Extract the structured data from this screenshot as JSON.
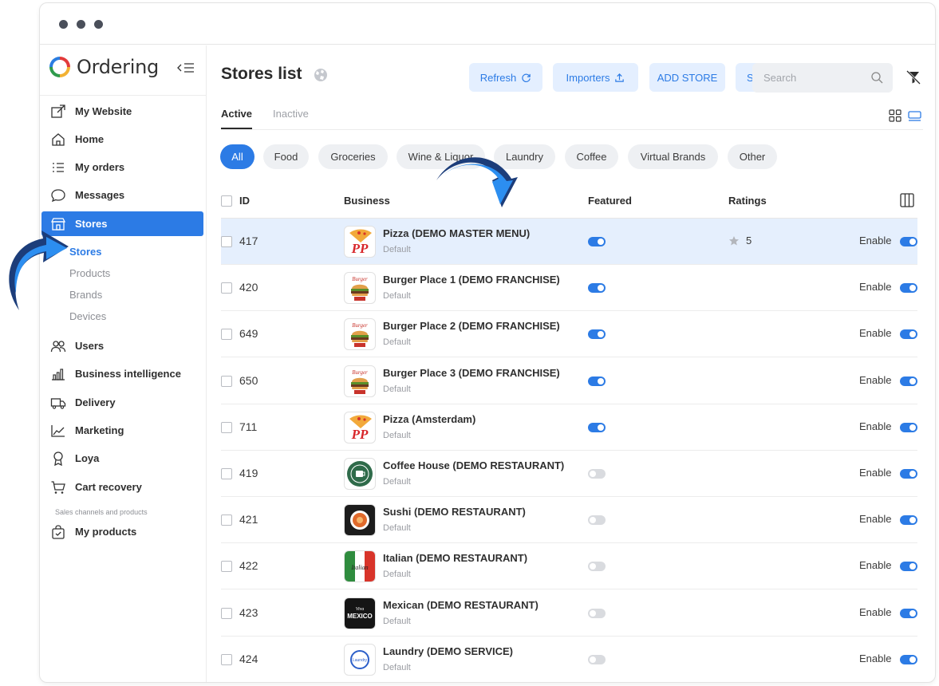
{
  "app": {
    "logo_text": "Ordering"
  },
  "colors": {
    "accent": "#2c7be5",
    "accent_light": "#e4efff",
    "row_highlight": "#e5effd"
  },
  "sidebar": {
    "items": [
      {
        "label": "My Website",
        "icon": "external-link-icon"
      },
      {
        "label": "Home",
        "icon": "home-icon"
      },
      {
        "label": "My orders",
        "icon": "list-icon"
      },
      {
        "label": "Messages",
        "icon": "chat-bubble-icon"
      },
      {
        "label": "Stores",
        "icon": "store-icon",
        "active": true
      },
      {
        "label": "Users",
        "icon": "users-icon"
      },
      {
        "label": "Business intelligence",
        "icon": "bar-chart-icon"
      },
      {
        "label": "Delivery",
        "icon": "truck-icon"
      },
      {
        "label": "Marketing",
        "icon": "line-chart-icon"
      },
      {
        "label": "Loya",
        "icon": "award-icon"
      },
      {
        "label": "Cart recovery",
        "icon": "cart-icon"
      },
      {
        "label": "My products",
        "icon": "bag-check-icon"
      }
    ],
    "sub_items": [
      "Stores",
      "Products",
      "Brands",
      "Devices"
    ],
    "caption": "Sales channels and products"
  },
  "header": {
    "title": "Stores list",
    "buttons": {
      "refresh": "Refresh",
      "importers": "Importers",
      "add_store": "ADD STORE",
      "sync": "Sync"
    },
    "search_placeholder": "Search"
  },
  "tabs": [
    "Active",
    "Inactive"
  ],
  "chips": [
    "All",
    "Food",
    "Groceries",
    "Wine & Liquor",
    "Laundry",
    "Coffee",
    "Virtual Brands",
    "Other"
  ],
  "table": {
    "columns": {
      "id": "ID",
      "business": "Business",
      "featured": "Featured",
      "ratings": "Ratings"
    },
    "rows": [
      {
        "id": "417",
        "name": "Pizza (DEMO MASTER MENU)",
        "sub": "Default",
        "featured": true,
        "rating": "5",
        "status": "Enable",
        "logo": "pizza-logo"
      },
      {
        "id": "420",
        "name": "Burger Place 1 (DEMO FRANCHISE)",
        "sub": "Default",
        "featured": true,
        "rating": "",
        "status": "Enable",
        "logo": "burger-logo"
      },
      {
        "id": "649",
        "name": "Burger Place 2 (DEMO FRANCHISE)",
        "sub": "Default",
        "featured": true,
        "rating": "",
        "status": "Enable",
        "logo": "burger-logo"
      },
      {
        "id": "650",
        "name": "Burger Place 3 (DEMO FRANCHISE)",
        "sub": "Default",
        "featured": true,
        "rating": "",
        "status": "Enable",
        "logo": "burger-logo"
      },
      {
        "id": "711",
        "name": "Pizza (Amsterdam)",
        "sub": "Default",
        "featured": true,
        "rating": "",
        "status": "Enable",
        "logo": "pizza-logo"
      },
      {
        "id": "419",
        "name": "Coffee House (DEMO RESTAURANT)",
        "sub": "Default",
        "featured": false,
        "rating": "",
        "status": "Enable",
        "logo": "coffee-logo"
      },
      {
        "id": "421",
        "name": "Sushi (DEMO RESTAURANT)",
        "sub": "Default",
        "featured": false,
        "rating": "",
        "status": "Enable",
        "logo": "sushi-logo"
      },
      {
        "id": "422",
        "name": "Italian (DEMO RESTAURANT)",
        "sub": "Default",
        "featured": false,
        "rating": "",
        "status": "Enable",
        "logo": "italian-logo"
      },
      {
        "id": "423",
        "name": "Mexican (DEMO RESTAURANT)",
        "sub": "Default",
        "featured": false,
        "rating": "",
        "status": "Enable",
        "logo": "mexican-logo"
      },
      {
        "id": "424",
        "name": "Laundry (DEMO SERVICE)",
        "sub": "Default",
        "featured": false,
        "rating": "",
        "status": "Enable",
        "logo": "laundry-logo"
      }
    ]
  }
}
